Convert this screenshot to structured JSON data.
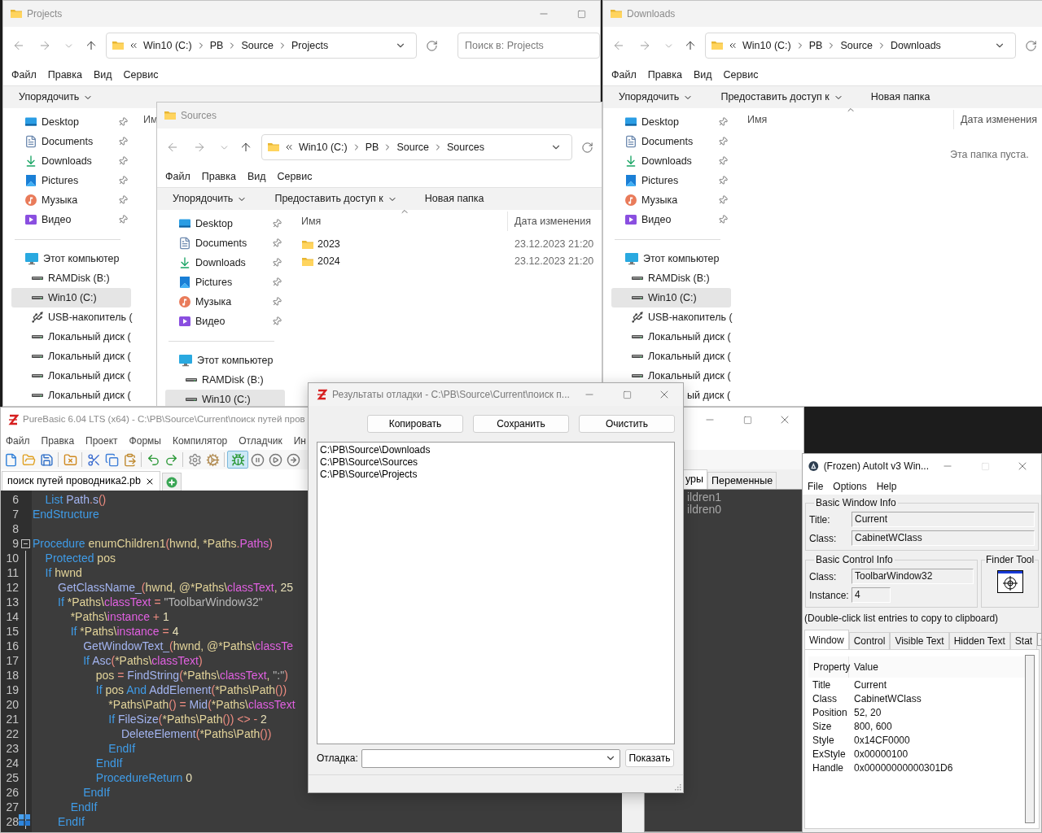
{
  "projects_window": {
    "title": "Projects",
    "title_buttons": [
      {
        "kind": "minimize",
        "disabled": false
      },
      {
        "kind": "maximize",
        "disabled": false
      }
    ],
    "path": [
      "Win10 (C:)",
      "PB",
      "Source",
      "Projects"
    ],
    "search": {
      "placeholder": "Поиск в: Projects"
    },
    "menu": [
      "Файл",
      "Правка",
      "Вид",
      "Сервис"
    ],
    "toolbar": [
      {
        "label": "Упорядочить",
        "dropdown": true
      }
    ],
    "quick_access": [
      {
        "label": "Desktop",
        "kind": "desktop",
        "pinned": true,
        "selected": false
      },
      {
        "label": "Documents",
        "kind": "documents",
        "pinned": true,
        "selected": false
      },
      {
        "label": "Downloads",
        "kind": "downloads",
        "pinned": true,
        "selected": false
      },
      {
        "label": "Pictures",
        "kind": "pictures",
        "pinned": true,
        "selected": false
      },
      {
        "label": "Музыка",
        "kind": "music",
        "pinned": true,
        "selected": false
      },
      {
        "label": "Видео",
        "kind": "video",
        "pinned": true,
        "selected": false
      }
    ],
    "this_pc": {
      "label": "Этот компьютер",
      "kind": "computer",
      "selected": false,
      "children": [
        {
          "label": "RAMDisk (B:)",
          "kind": "drive",
          "selected": false
        },
        {
          "label": "Win10 (C:)",
          "kind": "drive",
          "selected": true
        },
        {
          "label": "USB-накопитель (",
          "kind": "usb",
          "selected": false
        },
        {
          "label": "Локальный диск (",
          "kind": "drive",
          "selected": false
        },
        {
          "label": "Локальный диск (",
          "kind": "drive",
          "selected": false
        },
        {
          "label": "Локальный диск (",
          "kind": "drive",
          "selected": false
        },
        {
          "label": "Локальный диск (",
          "kind": "drive",
          "selected": false
        }
      ]
    },
    "columns": [
      {
        "label": "Им"
      }
    ]
  },
  "downloads_window": {
    "title": "Downloads",
    "path": [
      "Win10 (C:)",
      "PB",
      "Source",
      "Downloads"
    ],
    "menu": [
      "Файл",
      "Правка",
      "Вид",
      "Сервис"
    ],
    "toolbar": [
      {
        "label": "Упорядочить",
        "dropdown": true
      },
      {
        "label": "Предоставить доступ к",
        "dropdown": true
      },
      {
        "label": "Новая папка",
        "dropdown": false
      }
    ],
    "quick_access": [
      {
        "label": "Desktop",
        "kind": "desktop",
        "pinned": true,
        "selected": false
      },
      {
        "label": "Documents",
        "kind": "documents",
        "pinned": true,
        "selected": false
      },
      {
        "label": "Downloads",
        "kind": "downloads",
        "pinned": true,
        "selected": false
      },
      {
        "label": "Pictures",
        "kind": "pictures",
        "pinned": true,
        "selected": false
      },
      {
        "label": "Музыка",
        "kind": "music",
        "pinned": true,
        "selected": false
      },
      {
        "label": "Видео",
        "kind": "video",
        "pinned": true,
        "selected": false
      }
    ],
    "this_pc": {
      "label": "Этот компьютер",
      "kind": "computer",
      "selected": false,
      "children": [
        {
          "label": "RAMDisk (B:)",
          "kind": "drive",
          "selected": false
        },
        {
          "label": "Win10 (C:)",
          "kind": "drive",
          "selected": true
        },
        {
          "label": "USB-накопитель (",
          "kind": "usb",
          "selected": false
        },
        {
          "label": "Локальный диск (",
          "kind": "drive",
          "selected": false
        },
        {
          "label": "Локальный диск (",
          "kind": "drive",
          "selected": false
        },
        {
          "label": "Локальный диск (",
          "kind": "drive",
          "selected": false
        },
        {
          "label": "ый диск (",
          "kind": "drive-partial",
          "selected": false
        }
      ]
    },
    "columns": [
      {
        "label": "Имя",
        "sorted": true
      },
      {
        "label": "Дата изменения",
        "sorted": false
      }
    ],
    "empty_message": "Эта папка пуста."
  },
  "sources_window": {
    "title": "Sources",
    "path": [
      "Win10 (C:)",
      "PB",
      "Source",
      "Sources"
    ],
    "menu": [
      "Файл",
      "Правка",
      "Вид",
      "Сервис"
    ],
    "toolbar": [
      {
        "label": "Упорядочить",
        "dropdown": true
      },
      {
        "label": "Предоставить доступ к",
        "dropdown": true
      },
      {
        "label": "Новая папка",
        "dropdown": false
      }
    ],
    "quick_access": [
      {
        "label": "Desktop",
        "kind": "desktop",
        "pinned": true,
        "selected": false
      },
      {
        "label": "Documents",
        "kind": "documents",
        "pinned": true,
        "selected": false
      },
      {
        "label": "Downloads",
        "kind": "downloads",
        "pinned": true,
        "selected": false
      },
      {
        "label": "Pictures",
        "kind": "pictures",
        "pinned": true,
        "selected": false
      },
      {
        "label": "Музыка",
        "kind": "music",
        "pinned": true,
        "selected": false
      },
      {
        "label": "Видео",
        "kind": "video",
        "pinned": true,
        "selected": false
      }
    ],
    "this_pc": {
      "label": "Этот компьютер",
      "kind": "computer",
      "selected": false,
      "children": [
        {
          "label": "RAMDisk (B:)",
          "kind": "drive",
          "selected": false
        },
        {
          "label": "Win10 (C:)",
          "kind": "drive",
          "selected": true
        }
      ]
    },
    "columns": [
      {
        "label": "Имя",
        "sorted": true
      },
      {
        "label": "Дата изменения",
        "sorted": false
      }
    ],
    "files": [
      {
        "name": "2023",
        "date": "23.12.2023 21:20",
        "selected": false
      },
      {
        "name": "2024",
        "date": "23.12.2023 21:20",
        "selected": false
      }
    ]
  },
  "purebasic_window": {
    "title": "PureBasic 6.04 LTS (x64) - C:\\PB\\Source\\Current\\поиск путей пров",
    "title_buttons": [
      {
        "kind": "minimize",
        "disabled": false
      },
      {
        "kind": "maximize",
        "disabled": false
      },
      {
        "kind": "close",
        "disabled": false
      }
    ],
    "menu": [
      "Файл",
      "Правка",
      "Проект",
      "Формы",
      "Компилятор",
      "Отладчик",
      "Ин"
    ],
    "debugger_enabled": true,
    "tabs": [
      {
        "label": "поиск путей проводника2.pb",
        "selected": true
      }
    ],
    "code": [
      {
        "number": "6",
        "tokens": [
          {
            "kind": "kw",
            "text": "    List"
          },
          {
            "kind": "fn",
            "text": " Path"
          },
          {
            "kind": "op",
            "text": "."
          },
          {
            "kind": "fn",
            "text": "s"
          },
          {
            "kind": "op",
            "text": "()"
          }
        ]
      },
      {
        "number": "7",
        "tokens": [
          {
            "kind": "kw",
            "text": "EndStructure"
          }
        ]
      },
      {
        "number": "8"
      },
      {
        "number": "9",
        "fold": true,
        "tokens": [
          {
            "kind": "kw",
            "text": "Procedure"
          },
          {
            "kind": "id",
            "text": " enumChildren1"
          },
          {
            "kind": "op",
            "text": "("
          },
          {
            "kind": "id",
            "text": "hwnd, *Paths"
          },
          {
            "kind": "op",
            "text": "."
          },
          {
            "kind": "field",
            "text": "Paths"
          },
          {
            "kind": "op",
            "text": ")"
          }
        ]
      },
      {
        "number": "10",
        "tokens": [
          {
            "kind": "kw",
            "text": "    Protected"
          },
          {
            "kind": "id",
            "text": " pos"
          }
        ]
      },
      {
        "number": "11",
        "tokens": [
          {
            "kind": "kw",
            "text": "    If"
          },
          {
            "kind": "id",
            "text": " hwnd"
          }
        ]
      },
      {
        "number": "12",
        "tokens": [
          {
            "kind": "fn",
            "text": "        GetClassName_"
          },
          {
            "kind": "op",
            "text": "("
          },
          {
            "kind": "id",
            "text": "hwnd, @*Paths\\"
          },
          {
            "kind": "field",
            "text": "classText"
          },
          {
            "kind": "id",
            "text": ", "
          },
          {
            "kind": "num",
            "text": "25"
          }
        ]
      },
      {
        "number": "13",
        "tokens": [
          {
            "kind": "kw",
            "text": "        If"
          },
          {
            "kind": "id",
            "text": " *Paths\\"
          },
          {
            "kind": "field",
            "text": "classText"
          },
          {
            "kind": "op",
            "text": " = "
          },
          {
            "kind": "str",
            "text": "\"ToolbarWindow32\""
          }
        ]
      },
      {
        "number": "14",
        "tokens": [
          {
            "kind": "id",
            "text": "            *Paths\\"
          },
          {
            "kind": "field",
            "text": "instance"
          },
          {
            "kind": "op",
            "text": " + "
          },
          {
            "kind": "num",
            "text": "1"
          }
        ]
      },
      {
        "number": "15",
        "tokens": [
          {
            "kind": "kw",
            "text": "            If"
          },
          {
            "kind": "id",
            "text": " *Paths\\"
          },
          {
            "kind": "field",
            "text": "instance"
          },
          {
            "kind": "op",
            "text": " = "
          },
          {
            "kind": "num",
            "text": "4"
          }
        ]
      },
      {
        "number": "16",
        "tokens": [
          {
            "kind": "fn",
            "text": "                GetWindowText_"
          },
          {
            "kind": "op",
            "text": "("
          },
          {
            "kind": "id",
            "text": "hwnd, @*Paths\\"
          },
          {
            "kind": "field",
            "text": "classTe"
          }
        ]
      },
      {
        "number": "17",
        "tokens": [
          {
            "kind": "kw",
            "text": "                If"
          },
          {
            "kind": "fn",
            "text": " Asc"
          },
          {
            "kind": "op",
            "text": "("
          },
          {
            "kind": "id",
            "text": "*Paths\\"
          },
          {
            "kind": "field",
            "text": "classText"
          },
          {
            "kind": "op",
            "text": ")"
          }
        ]
      },
      {
        "number": "18",
        "tokens": [
          {
            "kind": "id",
            "text": "                    pos"
          },
          {
            "kind": "op",
            "text": " = "
          },
          {
            "kind": "fn",
            "text": "FindString"
          },
          {
            "kind": "op",
            "text": "("
          },
          {
            "kind": "id",
            "text": "*Paths\\"
          },
          {
            "kind": "field",
            "text": "classText"
          },
          {
            "kind": "id",
            "text": ", "
          },
          {
            "kind": "str",
            "text": "\":\""
          },
          {
            "kind": "op",
            "text": ")"
          }
        ]
      },
      {
        "number": "19",
        "tokens": [
          {
            "kind": "kw",
            "text": "                    If"
          },
          {
            "kind": "id",
            "text": " pos "
          },
          {
            "kind": "kw",
            "text": "And"
          },
          {
            "kind": "fn",
            "text": " AddElement"
          },
          {
            "kind": "op",
            "text": "("
          },
          {
            "kind": "id",
            "text": "*Paths\\Path"
          },
          {
            "kind": "op",
            "text": "())"
          }
        ]
      },
      {
        "number": "20",
        "tokens": [
          {
            "kind": "id",
            "text": "                        *Paths\\Path"
          },
          {
            "kind": "op",
            "text": "() = "
          },
          {
            "kind": "fn",
            "text": "Mid"
          },
          {
            "kind": "op",
            "text": "("
          },
          {
            "kind": "id",
            "text": "*Paths\\"
          },
          {
            "kind": "field",
            "text": "classText"
          }
        ]
      },
      {
        "number": "21",
        "tokens": [
          {
            "kind": "kw",
            "text": "                        If"
          },
          {
            "kind": "fn",
            "text": " FileSize"
          },
          {
            "kind": "op",
            "text": "("
          },
          {
            "kind": "id",
            "text": "*Paths\\Path"
          },
          {
            "kind": "op",
            "text": "()) <> - "
          },
          {
            "kind": "num",
            "text": "2"
          }
        ]
      },
      {
        "number": "22",
        "tokens": [
          {
            "kind": "fn",
            "text": "                            DeleteElement"
          },
          {
            "kind": "op",
            "text": "("
          },
          {
            "kind": "id",
            "text": "*Paths\\Path"
          },
          {
            "kind": "op",
            "text": "())"
          }
        ]
      },
      {
        "number": "23",
        "tokens": [
          {
            "kind": "kw",
            "text": "                        EndIf"
          }
        ]
      },
      {
        "number": "24",
        "tokens": [
          {
            "kind": "kw",
            "text": "                    EndIf"
          }
        ]
      },
      {
        "number": "25",
        "tokens": [
          {
            "kind": "kw",
            "text": "                    ProcedureReturn"
          },
          {
            "kind": "num",
            "text": " 0"
          }
        ]
      },
      {
        "number": "26",
        "tokens": [
          {
            "kind": "kw",
            "text": "                EndIf"
          }
        ]
      },
      {
        "number": "27",
        "tokens": [
          {
            "kind": "kw",
            "text": "            EndIf"
          }
        ]
      },
      {
        "number": "28",
        "tokens": [
          {
            "kind": "kw",
            "text": "        EndIf"
          }
        ]
      }
    ],
    "side_tabs": [
      {
        "label": "уры",
        "selected": true
      },
      {
        "label": "Переменные",
        "selected": false
      }
    ],
    "side_list": [
      "ildren1",
      "ildren0"
    ]
  },
  "debug_output_window": {
    "title": "Результаты отладки - C:\\PB\\Source\\Current\\поиск п...",
    "title_buttons": [
      {
        "kind": "minimize",
        "disabled": false
      },
      {
        "kind": "maximize",
        "disabled": false
      },
      {
        "kind": "close",
        "disabled": false
      }
    ],
    "buttons": [
      "Копировать",
      "Сохранить",
      "Очистить"
    ],
    "output": [
      "C:\\PB\\Source\\Downloads",
      "C:\\PB\\Source\\Sources",
      "C:\\PB\\Source\\Projects"
    ],
    "filter_label": "Отладка:",
    "show_button": "Показать"
  },
  "autoit_window": {
    "title": "(Frozen) AutoIt v3 Win...",
    "title_buttons": [
      {
        "kind": "minimize",
        "disabled": false
      },
      {
        "kind": "maximize",
        "disabled": true
      },
      {
        "kind": "close",
        "disabled": false
      }
    ],
    "menu": [
      "File",
      "Options",
      "Help"
    ],
    "window_info": {
      "title": "Basic Window Info",
      "fields": [
        {
          "label": "Title:",
          "value": "Current"
        },
        {
          "label": "Class:",
          "value": "CabinetWClass"
        }
      ]
    },
    "control_info": {
      "title": "Basic Control Info",
      "fields": [
        {
          "label": "Class:",
          "value": "ToolbarWindow32"
        },
        {
          "label": "Instance:",
          "value": "4"
        }
      ]
    },
    "finder": {
      "title": "Finder Tool"
    },
    "hint": "(Double-click list entries to copy to clipboard)",
    "tabs": [
      {
        "label": "Window",
        "selected": true
      },
      {
        "label": "Control",
        "selected": false
      },
      {
        "label": "Visible Text",
        "selected": false
      },
      {
        "label": "Hidden Text",
        "selected": false
      },
      {
        "label": "Stat",
        "selected": false
      }
    ],
    "table": {
      "columns": [
        "Property",
        "Value"
      ],
      "rows": [
        [
          "Title",
          "Current"
        ],
        [
          "Class",
          "CabinetWClass"
        ],
        [
          "Position",
          "52, 20"
        ],
        [
          "Size",
          "800, 600"
        ],
        [
          "Style",
          "0x14CF0000"
        ],
        [
          "ExStyle",
          "0x00000100"
        ],
        [
          "Handle",
          "0x00000000000301D6"
        ]
      ]
    }
  }
}
